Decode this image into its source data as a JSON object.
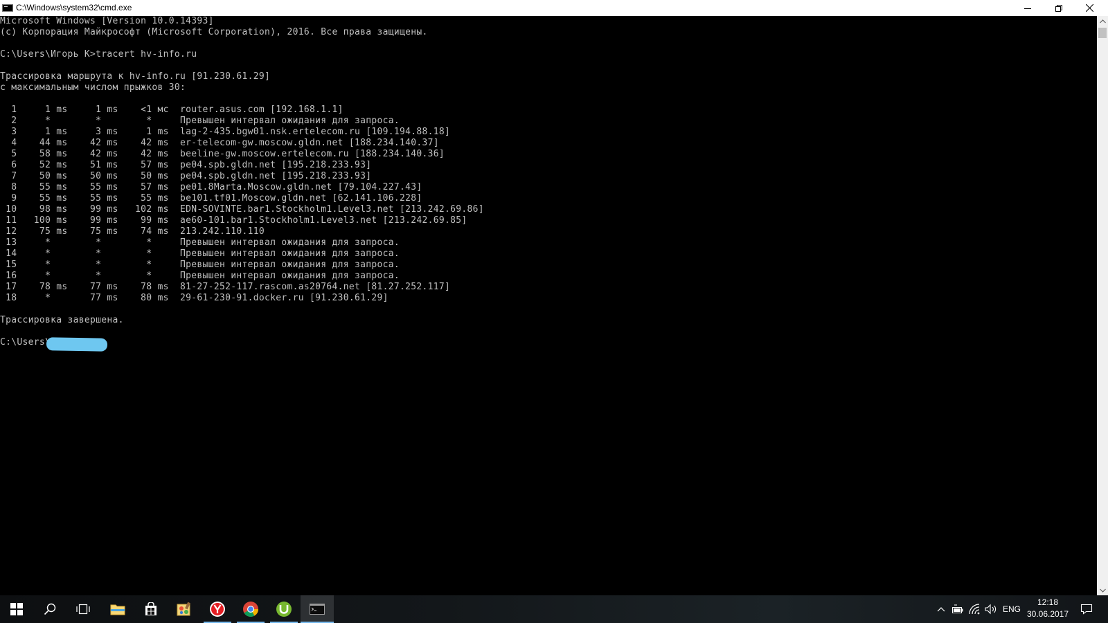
{
  "window": {
    "title": "C:\\Windows\\system32\\cmd.exe",
    "controls": [
      "minimize-icon",
      "restore-icon",
      "close-icon"
    ]
  },
  "console": {
    "lines": [
      "Microsoft Windows [Version 10.0.14393]",
      "(c) Корпорация Майкрософт (Microsoft Corporation), 2016. Все права защищены.",
      "",
      "C:\\Users\\Игорь К>tracert hv-info.ru",
      "",
      "Трассировка маршрута к hv-info.ru [91.230.61.29]",
      "с максимальным числом прыжков 30:",
      "",
      "  1     1 ms     1 ms    <1 мс  router.asus.com [192.168.1.1]",
      "  2     *        *        *     Превышен интервал ожидания для запроса.",
      "  3     1 ms     3 ms     1 ms  lag-2-435.bgw01.nsk.ertelecom.ru [109.194.88.18]",
      "  4    44 ms    42 ms    42 ms  er-telecom-gw.moscow.gldn.net [188.234.140.37]",
      "  5    58 ms    42 ms    42 ms  beeline-gw.moscow.ertelecom.ru [188.234.140.36]",
      "  6    52 ms    51 ms    57 ms  pe04.spb.gldn.net [195.218.233.93]",
      "  7    50 ms    50 ms    50 ms  pe04.spb.gldn.net [195.218.233.93]",
      "  8    55 ms    55 ms    57 ms  pe01.8Marta.Moscow.gldn.net [79.104.227.43]",
      "  9    55 ms    55 ms    55 ms  be101.tf01.Moscow.gldn.net [62.141.106.228]",
      " 10    98 ms    99 ms   102 ms  EDN-SOVINTE.bar1.Stockholm1.Level3.net [213.242.69.86]",
      " 11   100 ms    99 ms    99 ms  ae60-101.bar1.Stockholm1.Level3.net [213.242.69.85]",
      " 12    75 ms    75 ms    74 ms  213.242.110.110",
      " 13     *        *        *     Превышен интервал ожидания для запроса.",
      " 14     *        *        *     Превышен интервал ожидания для запроса.",
      " 15     *        *        *     Превышен интервал ожидания для запроса.",
      " 16     *        *        *     Превышен интервал ожидания для запроса.",
      " 17    78 ms    77 ms    78 ms  81-27-252-117.rascom.as20764.net [81.27.252.117]",
      " 18     *       77 ms    80 ms  29-61-230-91.docker.ru [91.230.61.29]",
      "",
      "Трассировка завершена.",
      "",
      "C:\\Users\\"
    ]
  },
  "taskbar": {
    "items": [
      {
        "icon": "start-windows-icon"
      },
      {
        "icon": "search-icon"
      },
      {
        "icon": "task-view-icon"
      },
      {
        "icon": "file-explorer-icon"
      },
      {
        "icon": "store-icon"
      },
      {
        "icon": "paint-app-icon"
      },
      {
        "icon": "yandex-browser-icon"
      },
      {
        "icon": "chrome-icon"
      },
      {
        "icon": "utorrent-icon"
      },
      {
        "icon": "cmd-icon"
      }
    ],
    "tray": {
      "language": "ENG",
      "time": "12:18",
      "date": "30.06.2017"
    }
  },
  "colors": {
    "console_bg": "#000000",
    "console_text": "#c0c0c0",
    "accent": "#76b9ed",
    "redaction": "#6ec7f0"
  }
}
